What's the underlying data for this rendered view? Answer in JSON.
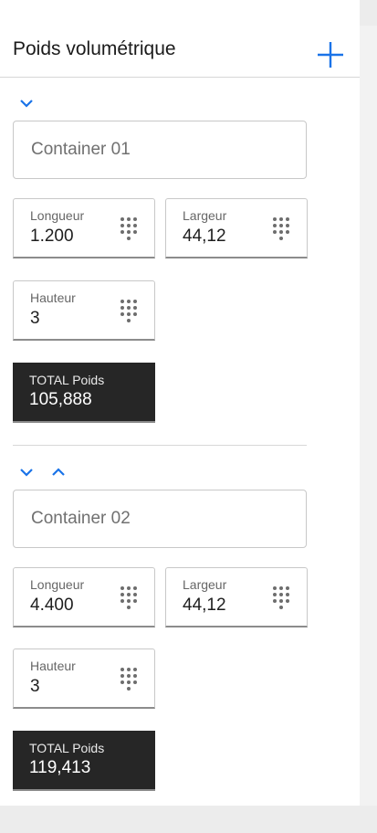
{
  "header": {
    "title": "Poids volumétrique",
    "add_icon": "plus-icon"
  },
  "colors": {
    "accent": "#1a73e8",
    "total_bg": "#262626"
  },
  "containers": [
    {
      "name": "Container 01",
      "longueur": {
        "label": "Longueur",
        "value": "1.200"
      },
      "largeur": {
        "label": "Largeur",
        "value": "44,12"
      },
      "hauteur": {
        "label": "Hauteur",
        "value": "3"
      },
      "total": {
        "label": "TOTAL Poids",
        "value": "105,888"
      }
    },
    {
      "name": "Container 02",
      "longueur": {
        "label": "Longueur",
        "value": "4.400"
      },
      "largeur": {
        "label": "Largeur",
        "value": "44,12"
      },
      "hauteur": {
        "label": "Hauteur",
        "value": "3"
      },
      "total": {
        "label": "TOTAL Poids",
        "value": "119,413"
      }
    }
  ]
}
